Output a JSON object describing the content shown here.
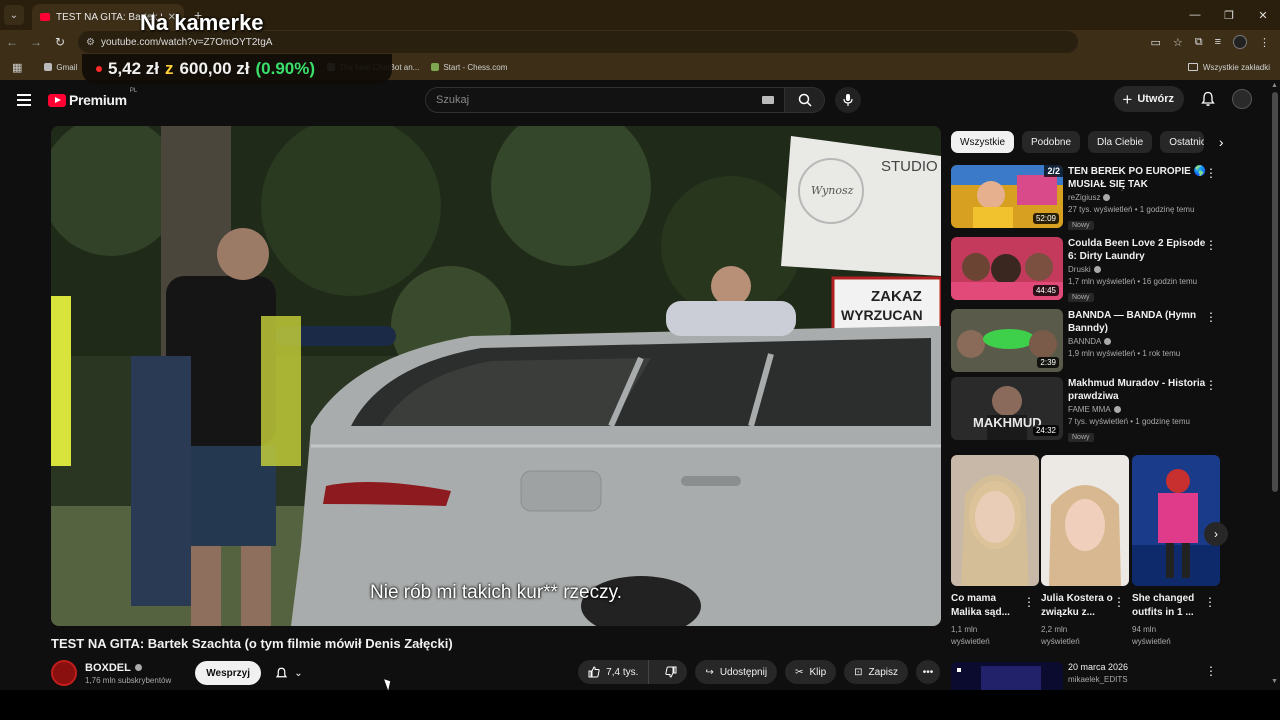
{
  "browser": {
    "tab_title": "TEST NA GITA: Bartek Szach",
    "url": "youtube.com/watch?v=Z7OmOYT2tgA",
    "bookmarks": [
      {
        "label": "Gmail"
      },
      {
        "label": "YouTube"
      },
      {
        "label": "The best ChatBot an..."
      },
      {
        "label": "Start - Chess.com"
      }
    ],
    "all_bookmarks": "Wszystkie zakładki"
  },
  "overlay": {
    "title": "Na kamerke",
    "amount": "5,42 zł",
    "separator": "z",
    "goal": "600,00 zł",
    "percent": "(0.90%)",
    "progress_percent": 0.9
  },
  "masthead": {
    "brand": "Premium",
    "region": "PL",
    "search_placeholder": "Szukaj",
    "create_label": "Utwórz"
  },
  "video": {
    "subtitle": "Nie rób mi takich kur** rzeczy.",
    "title": "TEST NA GITA: Bartek Szachta (o tym filmie mówił Denis Załęcki)",
    "sign_text_1": "STUDIO",
    "sign_text_2": "ZAKAZ",
    "sign_text_3": "WYRZUCAN",
    "sign_logo": "Wynosz"
  },
  "channel": {
    "name": "BOXDEL",
    "subs": "1,76 mln subskrybentów",
    "support_label": "Wesprzyj"
  },
  "actions": {
    "likes": "7,4 tys.",
    "share": "Udostępnij",
    "clip": "Klip",
    "save": "Zapisz"
  },
  "chips": [
    "Wszystkie",
    "Podobne",
    "Dla Ciebie",
    "Ostatnio"
  ],
  "recommendations": [
    {
      "title": "TEN BEREK PO EUROPIE 🌎 MUSIAŁ SIĘ TAK SKOŃCZYĆ... 😂",
      "channel": "reZigiusz",
      "stats": "27 tys. wyświetleń • 1 godzinę temu",
      "badge": "Nowy",
      "duration": "52:09",
      "playlist": "2/2"
    },
    {
      "title": "Coulda Been Love 2 Episode 6: Dirty Laundry",
      "channel": "Druski",
      "stats": "1,7 mln wyświetleń • 16 godzin temu",
      "badge": "Nowy",
      "duration": "44:45"
    },
    {
      "title": "BANNDA — BANDA (Hymn Banndy)",
      "channel": "BANNDA",
      "stats": "1,9 mln wyświetleń • 1 rok temu",
      "badge": "",
      "duration": "2:39"
    },
    {
      "title": "Makhmud Muradov - Historia prawdziwa",
      "channel": "FAME MMA",
      "stats": "7 tys. wyświetleń • 1 godzinę temu",
      "badge": "Nowy",
      "duration": "24:32"
    }
  ],
  "shorts": [
    {
      "title": "Co mama Malika sąd...",
      "views": "1,1 mln wyświetleń"
    },
    {
      "title": "Julia Kostera o związku z...",
      "views": "2,2 mln wyświetleń"
    },
    {
      "title": "She changed outfits in 1 ...",
      "views": "94 mln wyświetleń"
    }
  ],
  "last_rec": {
    "date": "20 marca 2026",
    "channel": "mikaelek_EDITS"
  }
}
